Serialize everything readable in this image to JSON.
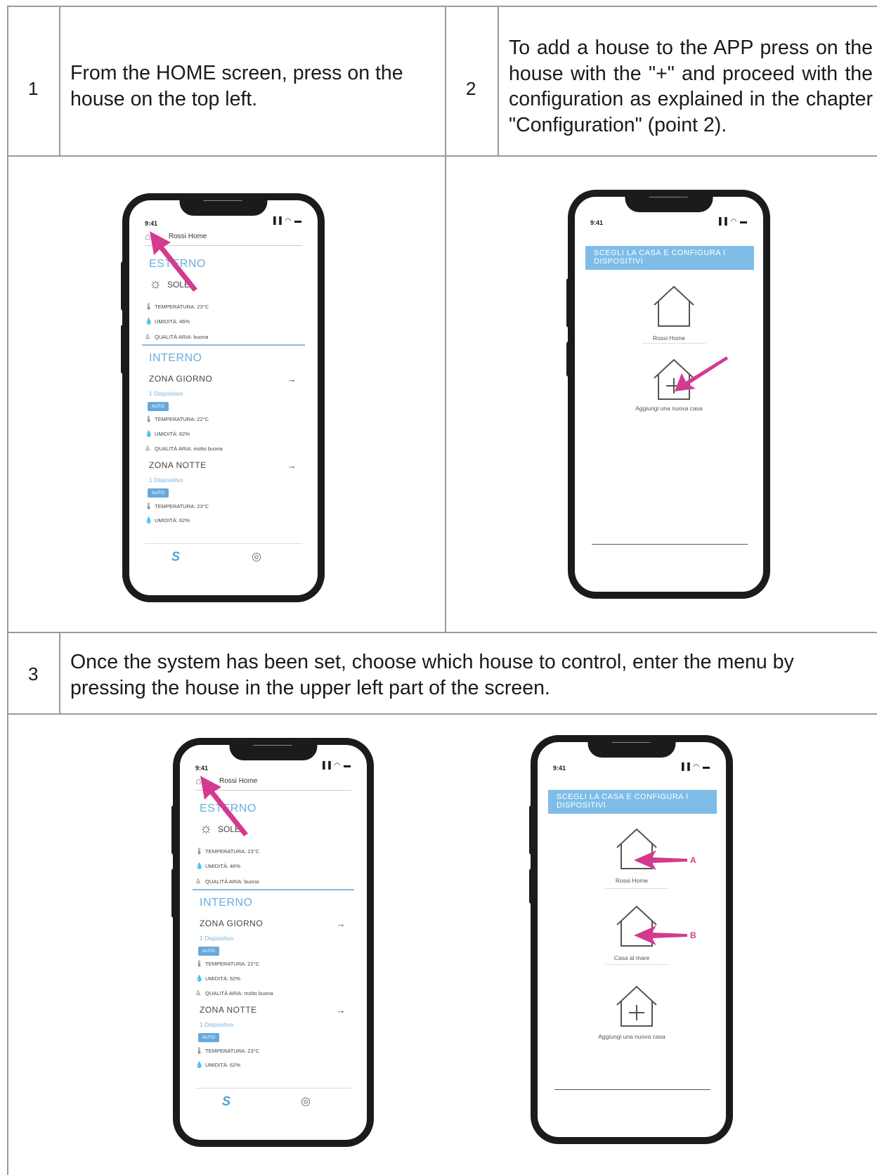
{
  "steps": [
    {
      "number": "1",
      "text": "From the HOME screen, press on the house on the top left."
    },
    {
      "number": "2",
      "text": "To add a house to the APP press on the house with the \"+\" and proceed with the configuration as explained in the chapter \"Configuration\" (point 2)."
    },
    {
      "number": "3",
      "text": "Once the system has been set, choose which house to control, enter the menu by pressing the house in the upper left part of the screen."
    }
  ],
  "home_screen": {
    "time": "9:41",
    "status_icons": "▐▐ ◠ ▬",
    "house_title": "Rossi Home",
    "esterno": {
      "heading": "ESTERNO",
      "weather": "SOLE",
      "temperatura": "TEMPERATURA: 23°C",
      "umidita": "UMIDITÀ: 46%",
      "qualita": "QUALITÀ ARIA: buona"
    },
    "interno_heading": "INTERNO",
    "zona_giorno": {
      "name": "ZONA GIORNO",
      "devices": "1 Dispositivo",
      "mode": "AUTO",
      "temperatura": "TEMPERATURA: 22°C",
      "umidita": "UMIDITÀ: 62%",
      "qualita": "QUALITÀ ARIA: molto buona"
    },
    "zona_notte": {
      "name": "ZONA NOTTE",
      "devices": "1 Dispositivo",
      "mode": "AUTO",
      "temperatura": "TEMPERATURA: 23°C",
      "umidita": "UMIDITÀ: 62%"
    },
    "icons": {
      "home": "home-icon",
      "sun": "sun-icon",
      "thermometer": "thermometer-icon",
      "drop": "drop-icon",
      "air": "air-quality-icon",
      "arrow": "arrow-right-icon",
      "logo": "brand-logo-icon",
      "user": "user-icon"
    }
  },
  "select_screen_a": {
    "time": "9:41",
    "banner": "SCEGLI LA CASA E CONFIGURA I DISPOSITIVI",
    "house_1": "Rossi Home",
    "add_house": "Aggiungi una nuova casa"
  },
  "select_screen_b": {
    "time": "9:41",
    "banner": "SCEGLI LA CASA E CONFIGURA I DISPOSITIVI",
    "house_1": "Rossi Home",
    "house_2": "Casa al mare",
    "add_house": "Aggiungi una nuova casa",
    "marker_a": "A",
    "marker_b": "B"
  },
  "colors": {
    "accent": "#66aedf",
    "arrow": "#d43a8f",
    "frame": "#1b1b1b",
    "grid": "#9a9a9a"
  }
}
